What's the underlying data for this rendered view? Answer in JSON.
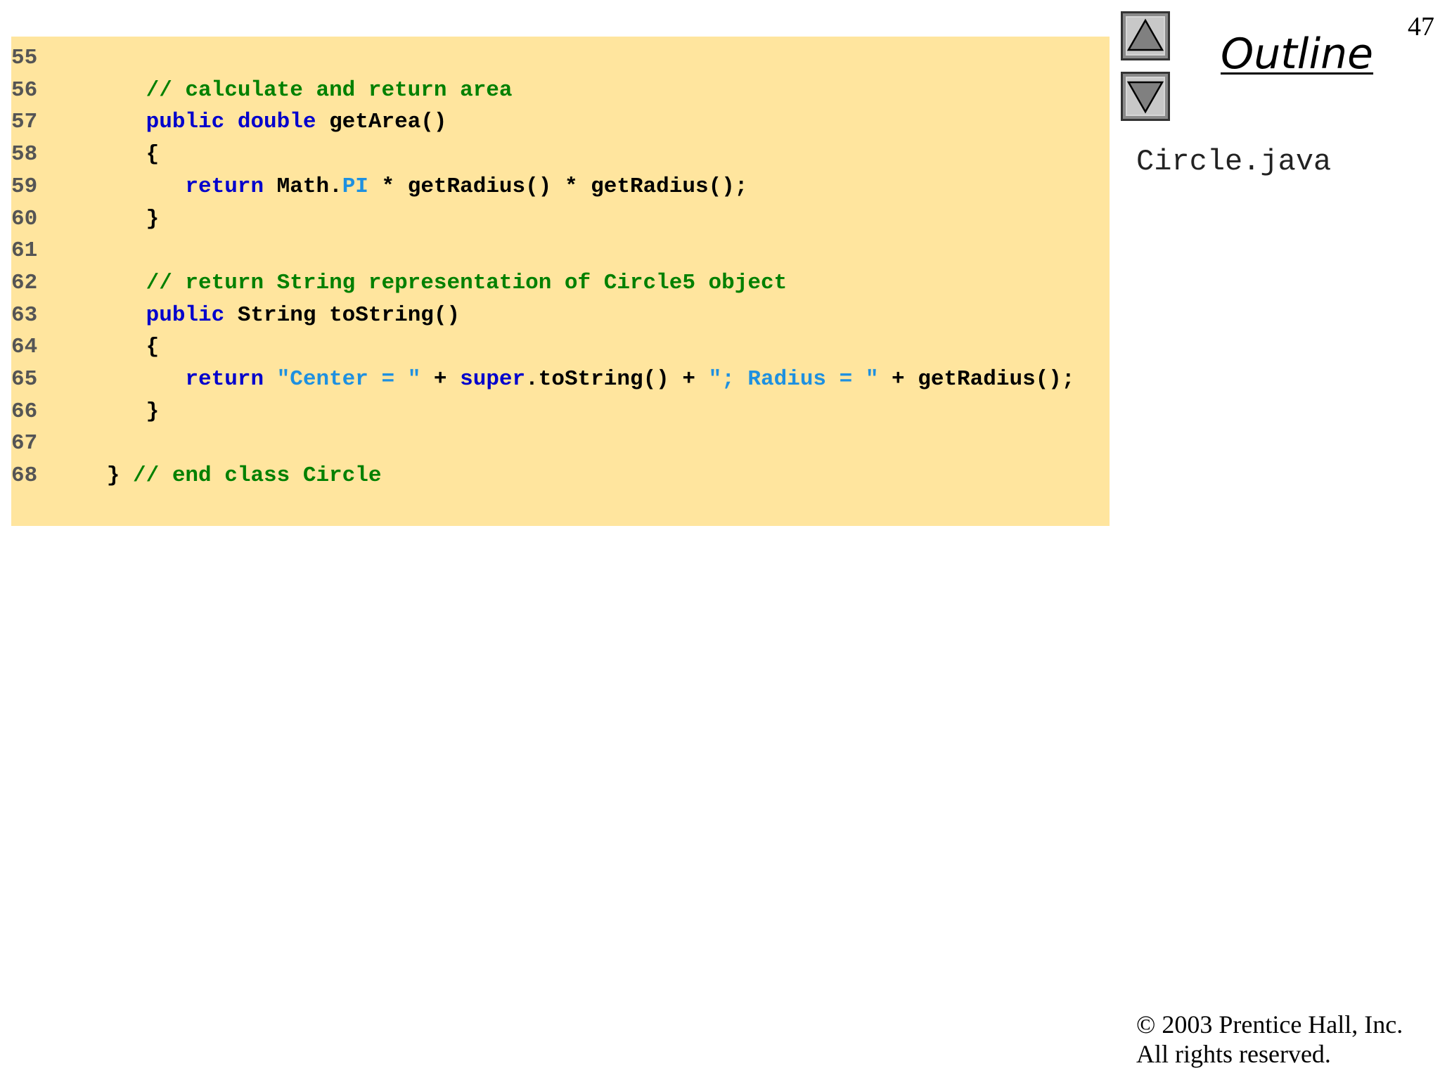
{
  "slide": {
    "page_number": "47",
    "outline_title": "Outline",
    "file_name": "Circle.java",
    "copyright_line1": "© 2003 Prentice Hall, Inc.",
    "copyright_line2": "All rights reserved."
  },
  "nav": {
    "up_icon": "triangle-up-icon",
    "down_icon": "triangle-down-icon"
  },
  "colors": {
    "panel_background": "#ffe59e",
    "keyword": "#0000cc",
    "comment": "#008000",
    "string_literal": "#1e90e0",
    "plain": "#000000",
    "line_number": "#555555"
  },
  "code": [
    {
      "num": "55",
      "tokens": []
    },
    {
      "num": "56",
      "tokens": [
        {
          "t": "      ",
          "k": "plain"
        },
        {
          "t": "// calculate and return area",
          "k": "comment"
        }
      ]
    },
    {
      "num": "57",
      "tokens": [
        {
          "t": "      ",
          "k": "plain"
        },
        {
          "t": "public double",
          "k": "keyword"
        },
        {
          "t": " getArea()",
          "k": "plain"
        }
      ]
    },
    {
      "num": "58",
      "tokens": [
        {
          "t": "      {",
          "k": "plain"
        }
      ]
    },
    {
      "num": "59",
      "tokens": [
        {
          "t": "         ",
          "k": "plain"
        },
        {
          "t": "return",
          "k": "keyword"
        },
        {
          "t": " Math.",
          "k": "plain"
        },
        {
          "t": "PI",
          "k": "string_literal"
        },
        {
          "t": " * getRadius() * getRadius();",
          "k": "plain"
        }
      ]
    },
    {
      "num": "60",
      "tokens": [
        {
          "t": "      }",
          "k": "plain"
        }
      ]
    },
    {
      "num": "61",
      "tokens": []
    },
    {
      "num": "62",
      "tokens": [
        {
          "t": "      ",
          "k": "plain"
        },
        {
          "t": "// return String representation of Circle5 object",
          "k": "comment"
        }
      ]
    },
    {
      "num": "63",
      "tokens": [
        {
          "t": "      ",
          "k": "plain"
        },
        {
          "t": "public",
          "k": "keyword"
        },
        {
          "t": " String toString()",
          "k": "plain"
        }
      ]
    },
    {
      "num": "64",
      "tokens": [
        {
          "t": "      {",
          "k": "plain"
        }
      ]
    },
    {
      "num": "65",
      "tokens": [
        {
          "t": "         ",
          "k": "plain"
        },
        {
          "t": "return",
          "k": "keyword"
        },
        {
          "t": " ",
          "k": "plain"
        },
        {
          "t": "\"Center = \"",
          "k": "string_literal"
        },
        {
          "t": " + ",
          "k": "plain"
        },
        {
          "t": "super",
          "k": "keyword"
        },
        {
          "t": ".toString() + ",
          "k": "plain"
        },
        {
          "t": "\"; Radius = \"",
          "k": "string_literal"
        },
        {
          "t": " + getRadius();",
          "k": "plain"
        }
      ]
    },
    {
      "num": "66",
      "tokens": [
        {
          "t": "      }",
          "k": "plain"
        }
      ]
    },
    {
      "num": "67",
      "tokens": []
    },
    {
      "num": "68",
      "tokens": [
        {
          "t": "   } ",
          "k": "plain"
        },
        {
          "t": "// end class Circle",
          "k": "comment"
        }
      ]
    }
  ]
}
